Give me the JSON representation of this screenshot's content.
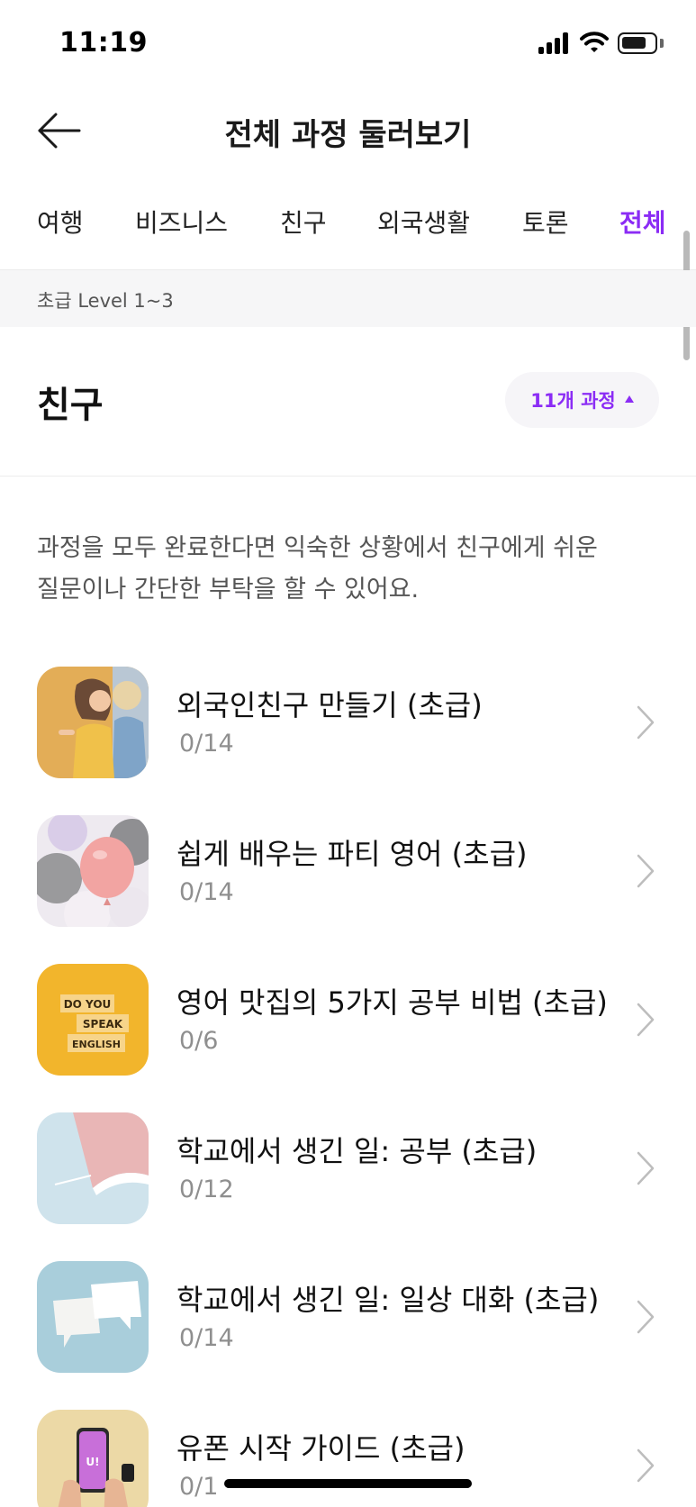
{
  "status_bar": {
    "time": "11:19",
    "icons": [
      "signal-icon",
      "wifi-icon",
      "battery-icon"
    ]
  },
  "header": {
    "back_icon": "arrow-left-icon",
    "title": "전체 과정 둘러보기"
  },
  "tabs": [
    {
      "label": "여행",
      "active": false
    },
    {
      "label": "비즈니스",
      "active": false
    },
    {
      "label": "친구",
      "active": false
    },
    {
      "label": "외국생활",
      "active": false
    },
    {
      "label": "토론",
      "active": false
    },
    {
      "label": "전체",
      "active": true
    }
  ],
  "level_band": {
    "label": "초급 Level 1~3"
  },
  "section": {
    "title": "친구",
    "count_label": "11개 과정",
    "toggle_icon": "caret-up-icon",
    "description_line1": "과정을 모두 완료한다면 익숙한 상황에서 친구에게 쉬운",
    "description_line2": "질문이나 간단한 부탁을 할 수 있어요."
  },
  "courses": [
    {
      "title": "외국인친구 만들기 (초급)",
      "progress": "0/14",
      "thumb": "friends-photo"
    },
    {
      "title": "쉽게 배우는 파티 영어 (초급)",
      "progress": "0/14",
      "thumb": "balloons-photo"
    },
    {
      "title": "영어 맛집의 5가지 공부 비법 (초급)",
      "progress": "0/6",
      "thumb": "do-you-speak-english-blocks",
      "thumb_text": [
        "DO YOU",
        "SPEAK",
        "ENGLISH"
      ]
    },
    {
      "title": "학교에서 생긴 일: 공부 (초급)",
      "progress": "0/12",
      "thumb": "notebook-photo"
    },
    {
      "title": "학교에서 생긴 일: 일상 대화 (초급)",
      "progress": "0/14",
      "thumb": "speech-bubbles-photo"
    },
    {
      "title": "유폰 시작 가이드 (초급)",
      "progress": "0/1",
      "thumb": "phone-in-hands-photo",
      "thumb_text": [
        "U!"
      ]
    }
  ],
  "colors": {
    "accent": "#8b2cf5",
    "text": "#111111",
    "muted": "#8f8f8f",
    "band": "#f6f6f7"
  }
}
